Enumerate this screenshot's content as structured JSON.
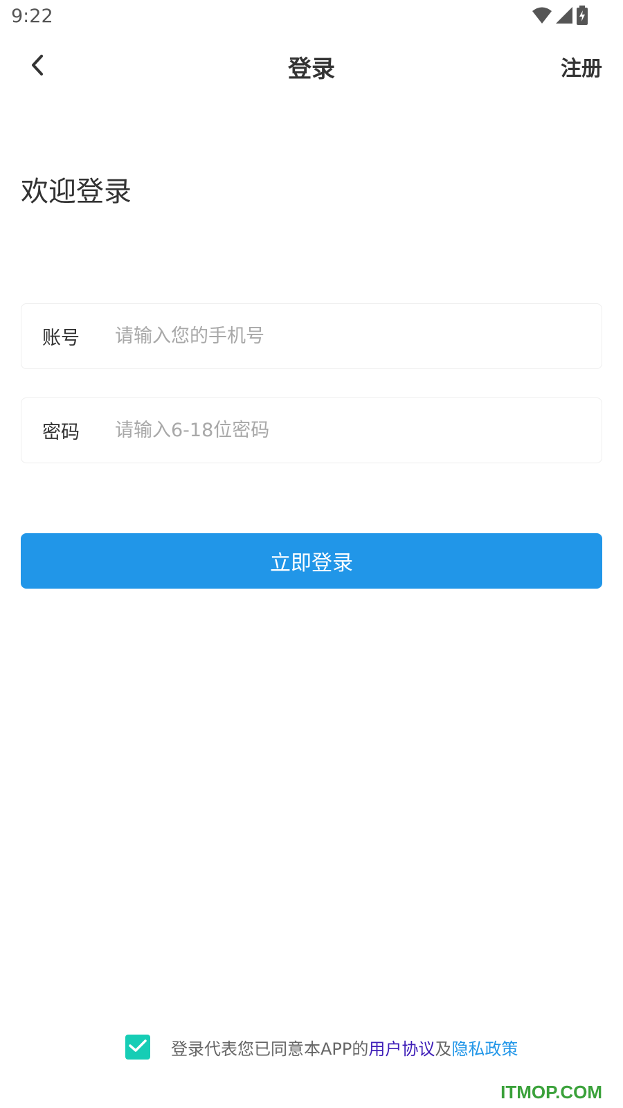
{
  "status_bar": {
    "time": "9:22",
    "icons": [
      "wifi-icon",
      "cell-signal-icon",
      "battery-charging-icon"
    ]
  },
  "nav": {
    "title": "登录",
    "register_label": "注册",
    "back_icon": "chevron-left-icon"
  },
  "welcome_text": "欢迎登录",
  "form": {
    "account": {
      "label": "账号",
      "placeholder": "请输入您的手机号",
      "value": ""
    },
    "password": {
      "label": "密码",
      "placeholder": "请输入6-18位密码",
      "value": ""
    }
  },
  "login_button_label": "立即登录",
  "agreement": {
    "checked": true,
    "prefix": "登录代表您已同意本APP的",
    "user_agreement": "用户协议",
    "conjunction": "及",
    "privacy_policy": "隐私政策"
  },
  "watermark": "ITMOP.COM",
  "colors": {
    "primary": "#2196e8",
    "checkbox": "#16cdb5",
    "user_link": "#3f1fb8",
    "watermark": "#3aa13a"
  }
}
